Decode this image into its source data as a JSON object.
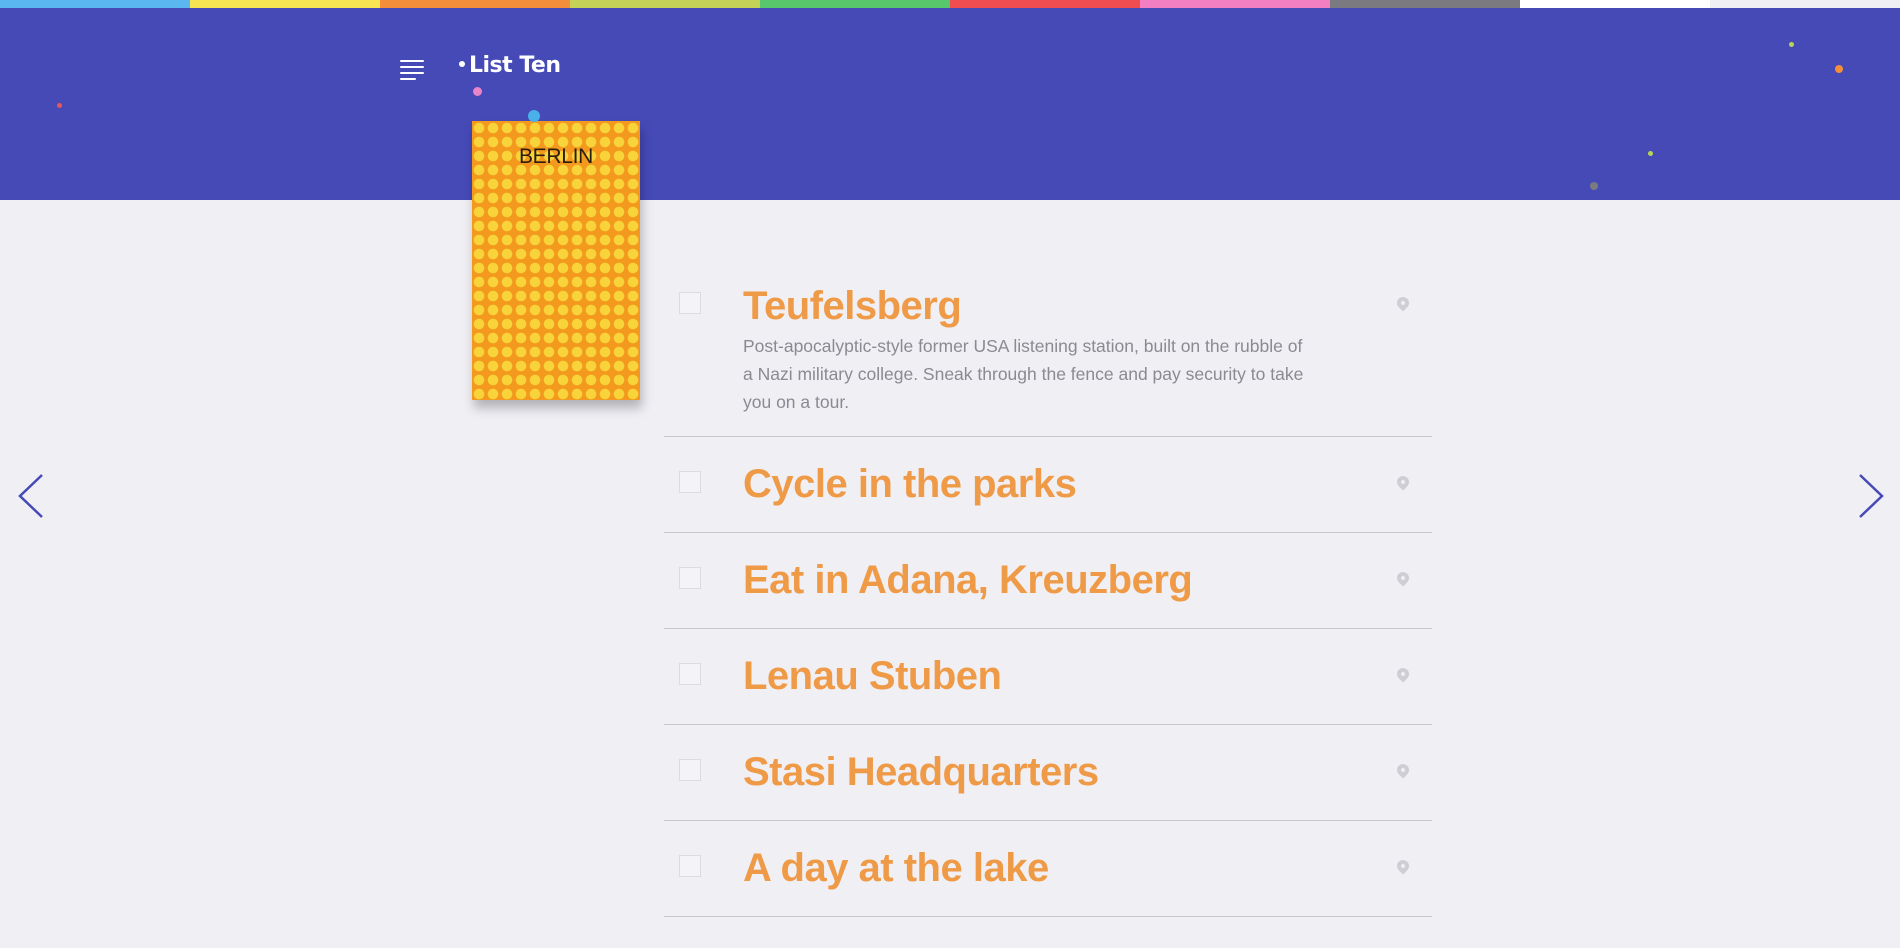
{
  "app": {
    "logo_text": "List Ten"
  },
  "color_strip": [
    "#5ab7ef",
    "#f7e453",
    "#f48e3b",
    "#c4d357",
    "#58c66a",
    "#ef4d4f",
    "#f27fc2",
    "#7a7a80",
    "#ffffff"
  ],
  "colors": {
    "header_bg": "#454ab7",
    "page_bg": "#f0eff4",
    "item_title": "#ef9a47",
    "item_desc": "#8a8a92",
    "book_base": "#f39a1e",
    "book_dots": "#f8d43a",
    "arrow": "#454ab7"
  },
  "book": {
    "title": "BERLIN"
  },
  "navigation": {
    "menu_icon": "hamburger-menu-icon",
    "prev_icon": "chevron-left-icon",
    "next_icon": "chevron-right-icon"
  },
  "items": [
    {
      "title": "Teufelsberg",
      "description": "Post-apocalyptic-style former USA listening station, built on the rubble of a Nazi military college. Sneak through the fence and pay security to take you on a tour.",
      "checked": false,
      "icon": "location-pin-icon"
    },
    {
      "title": "Cycle in the parks",
      "checked": false,
      "icon": "location-pin-icon"
    },
    {
      "title": "Eat in Adana, Kreuzberg",
      "checked": false,
      "icon": "location-pin-icon"
    },
    {
      "title": "Lenau Stuben",
      "checked": false,
      "icon": "location-pin-icon"
    },
    {
      "title": "Stasi Headquarters",
      "checked": false,
      "icon": "location-pin-icon"
    },
    {
      "title": "A day at the lake",
      "checked": false,
      "icon": "location-pin-icon"
    }
  ]
}
